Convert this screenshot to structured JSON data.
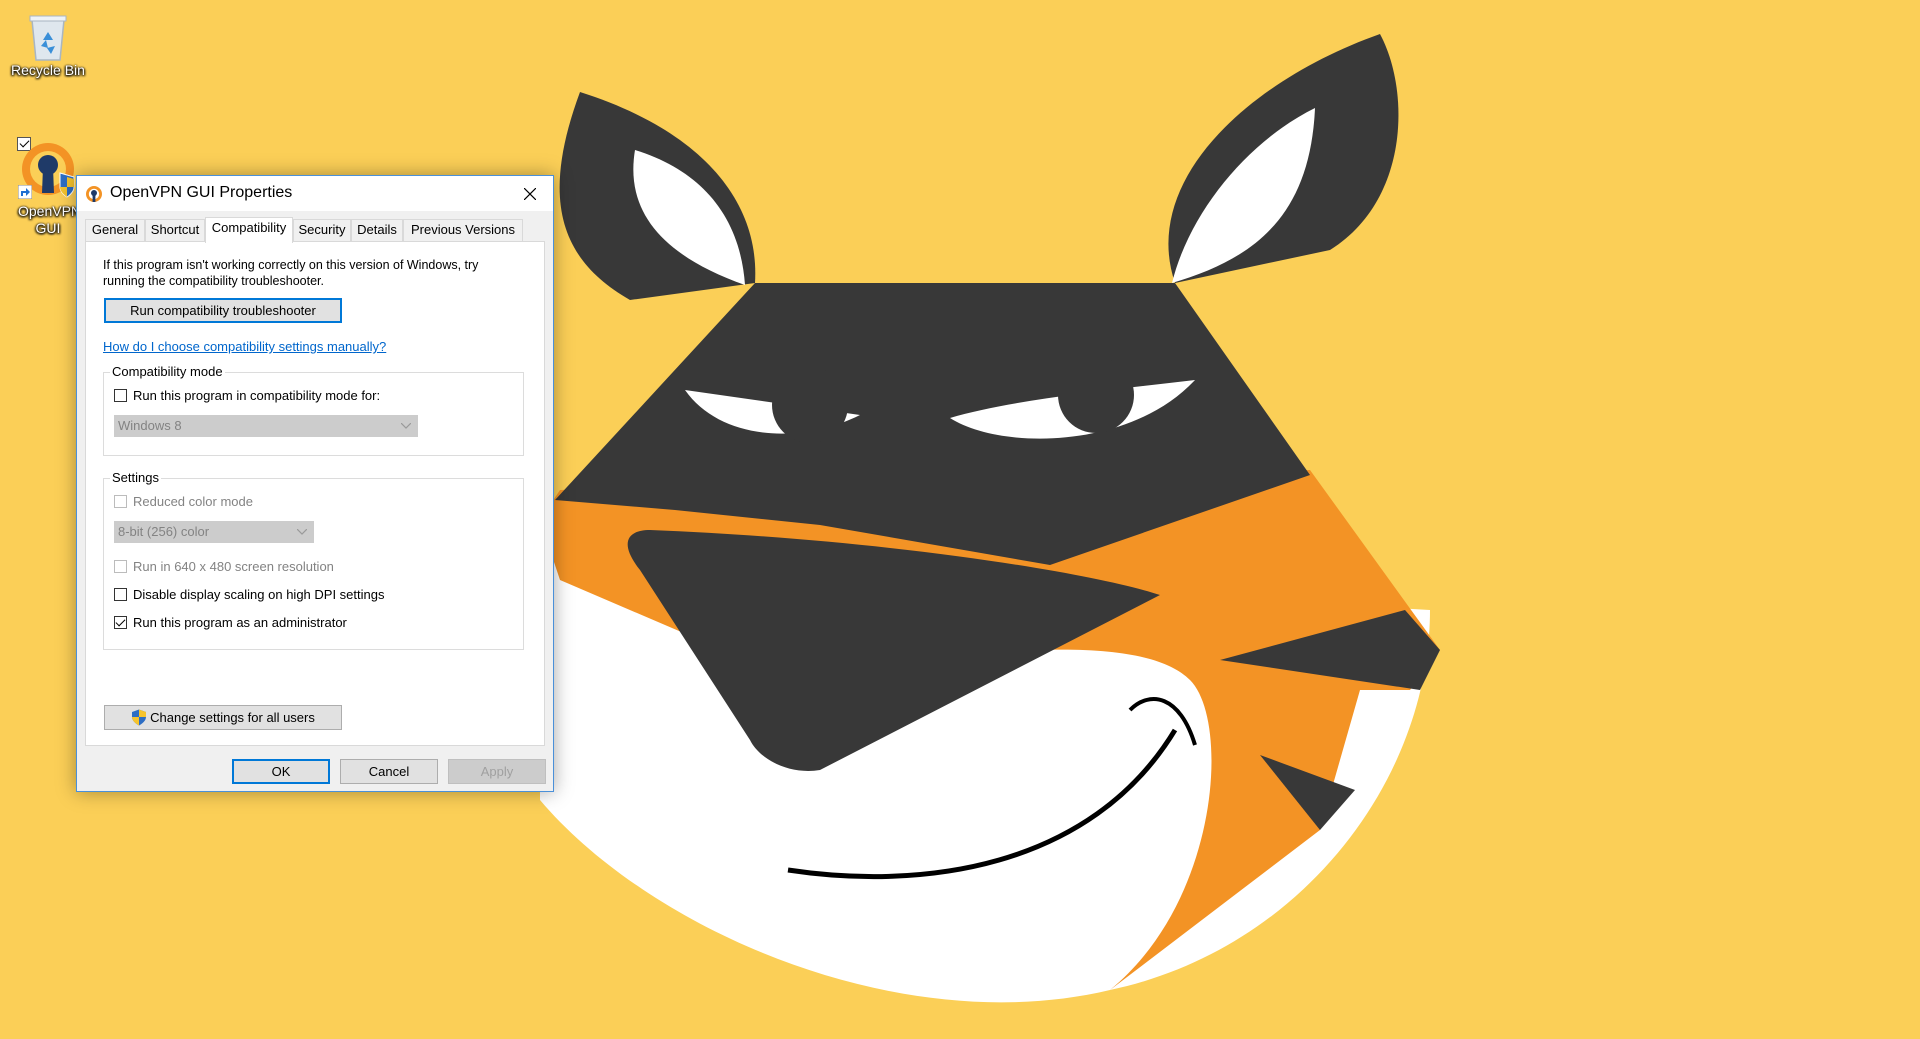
{
  "desktop": {
    "icons": [
      {
        "label": "Recycle Bin",
        "icon": "recycle-bin-icon"
      },
      {
        "label": "OpenVPN GUI",
        "icon": "openvpn-icon"
      }
    ]
  },
  "dialog": {
    "title": "OpenVPN GUI Properties",
    "tabs": [
      {
        "label": "General"
      },
      {
        "label": "Shortcut"
      },
      {
        "label": "Compatibility",
        "active": true
      },
      {
        "label": "Security"
      },
      {
        "label": "Details"
      },
      {
        "label": "Previous Versions"
      }
    ],
    "intro_text": "If this program isn't working correctly on this version of Windows, try running the compatibility troubleshooter.",
    "troubleshooter_button": "Run compatibility troubleshooter",
    "manual_link": "How do I choose compatibility settings manually?",
    "compat_mode": {
      "legend": "Compatibility mode",
      "checkbox_label": "Run this program in compatibility mode for:",
      "checked": false,
      "os_select": "Windows 8"
    },
    "settings": {
      "legend": "Settings",
      "reduced_color": {
        "label": "Reduced color mode",
        "checked": false,
        "enabled": false
      },
      "color_select": "8-bit (256) color",
      "resolution": {
        "label": "Run in 640 x 480 screen resolution",
        "checked": false,
        "enabled": false
      },
      "dpi": {
        "label": "Disable display scaling on high DPI settings",
        "checked": false
      },
      "admin": {
        "label": "Run this program as an administrator",
        "checked": true
      }
    },
    "change_all_button": "Change settings for all users",
    "ok_button": "OK",
    "cancel_button": "Cancel",
    "apply_button": "Apply"
  },
  "colors": {
    "desktop_bg": "#fbcf57",
    "accent": "#0078d7",
    "link": "#0066cc",
    "tiger_dark": "#383838",
    "tiger_orange": "#f39325"
  }
}
